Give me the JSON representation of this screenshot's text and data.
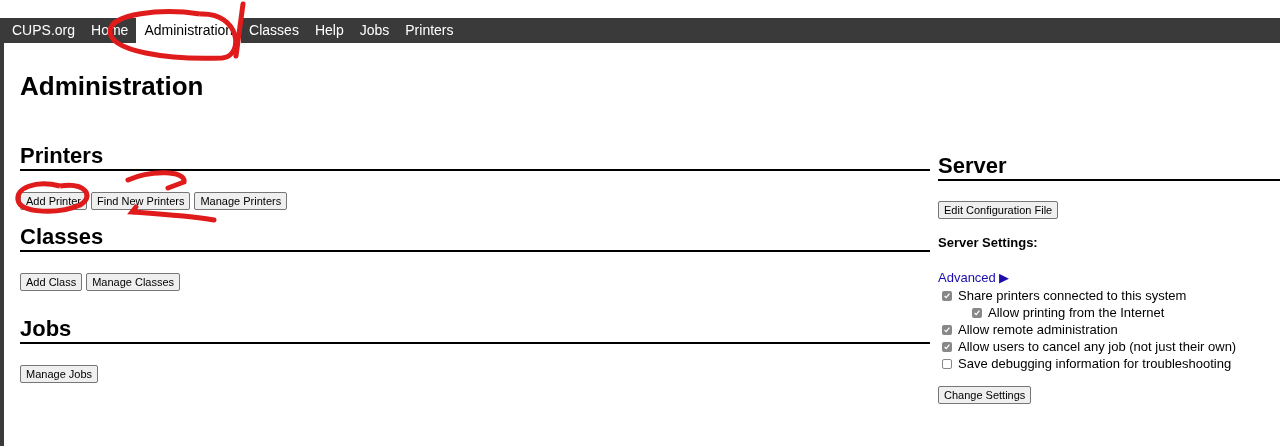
{
  "nav": [
    {
      "label": "CUPS.org",
      "selected": false
    },
    {
      "label": "Home",
      "selected": false
    },
    {
      "label": "Administration",
      "selected": true
    },
    {
      "label": "Classes",
      "selected": false
    },
    {
      "label": "Help",
      "selected": false
    },
    {
      "label": "Jobs",
      "selected": false
    },
    {
      "label": "Printers",
      "selected": false
    }
  ],
  "title": "Administration",
  "sections": [
    {
      "heading": "Printers",
      "buttons": [
        "Add Printer",
        "Find New Printers",
        "Manage Printers"
      ]
    },
    {
      "heading": "Classes",
      "buttons": [
        "Add Class",
        "Manage Classes"
      ]
    },
    {
      "heading": "Jobs",
      "buttons": [
        "Manage Jobs"
      ]
    }
  ],
  "server": {
    "heading": "Server",
    "button": "Edit Configuration File",
    "settings_label": "Server Settings:",
    "advanced_link": "Advanced ▶",
    "options": [
      {
        "label": "Share printers connected to this system",
        "checked": true,
        "children": [
          {
            "label": "Allow printing from the Internet",
            "checked": true
          }
        ]
      },
      {
        "label": "Allow remote administration",
        "checked": true
      },
      {
        "label": "Allow users to cancel any job (not just their own)",
        "checked": true
      },
      {
        "label": "Save debugging information for troubleshooting",
        "checked": false
      }
    ],
    "submit": "Change Settings"
  }
}
